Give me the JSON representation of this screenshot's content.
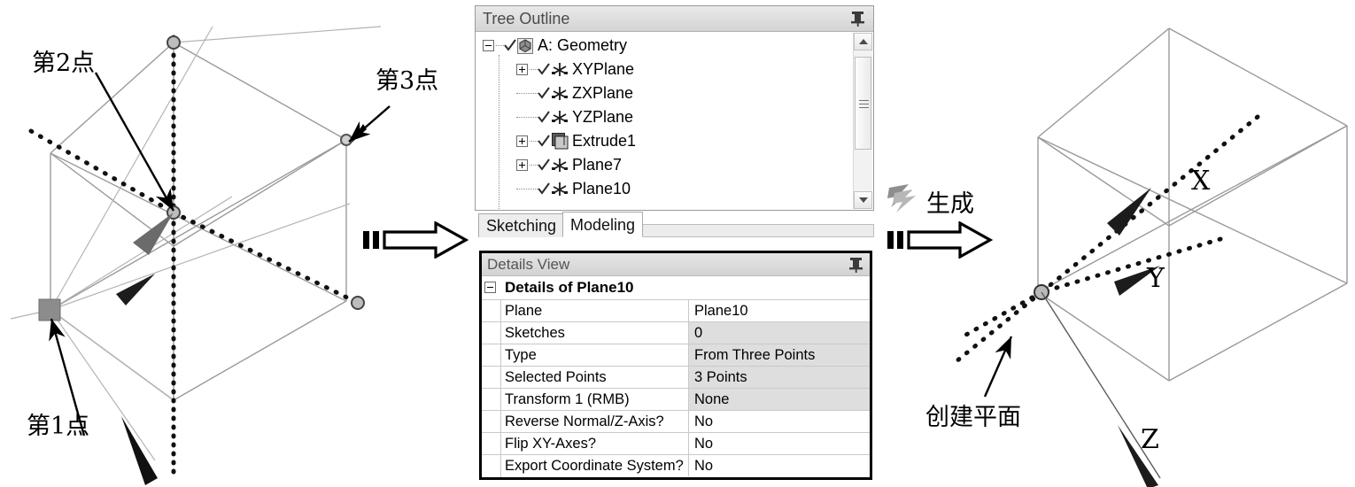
{
  "tree_panel": {
    "title": "Tree Outline",
    "pin_icon": "pin-icon",
    "items": [
      {
        "label": "A: Geometry",
        "icon": "geometry-icon",
        "expander": "minus",
        "depth": 0,
        "checked": true
      },
      {
        "label": "XYPlane",
        "icon": "plane-axis-icon",
        "expander": "plus",
        "depth": 1,
        "checked": true
      },
      {
        "label": "ZXPlane",
        "icon": "plane-axis-icon",
        "expander": "none",
        "depth": 1,
        "checked": true
      },
      {
        "label": "YZPlane",
        "icon": "plane-axis-icon",
        "expander": "none",
        "depth": 1,
        "checked": true
      },
      {
        "label": "Extrude1",
        "icon": "extrude-icon",
        "expander": "plus",
        "depth": 1,
        "checked": true
      },
      {
        "label": "Plane7",
        "icon": "plane-axis-icon",
        "expander": "plus",
        "depth": 1,
        "checked": true
      },
      {
        "label": "Plane10",
        "icon": "plane-axis-icon",
        "expander": "none",
        "depth": 1,
        "checked": true
      }
    ],
    "scrollbar": {
      "up": "scroll-up-arrow",
      "down": "scroll-down-arrow",
      "thumb": "scroll-thumb"
    },
    "tabs": [
      {
        "label": "Sketching",
        "active": false
      },
      {
        "label": "Modeling",
        "active": true
      }
    ]
  },
  "details_panel": {
    "title": "Details View",
    "pin_icon": "pin-icon",
    "section_header": "Details of Plane10",
    "rows": [
      {
        "key": "Plane",
        "value": "Plane10",
        "shaded": false
      },
      {
        "key": "Sketches",
        "value": "0",
        "shaded": true
      },
      {
        "key": "Type",
        "value": "From Three Points",
        "shaded": true
      },
      {
        "key": "Selected Points",
        "value": "3 Points",
        "shaded": true
      },
      {
        "key": "Transform 1 (RMB)",
        "value": "None",
        "shaded": true
      },
      {
        "key": "Reverse Normal/Z-Axis?",
        "value": "No",
        "shaded": false
      },
      {
        "key": "Flip XY-Axes?",
        "value": "No",
        "shaded": false
      },
      {
        "key": "Export Coordinate System?",
        "value": "No",
        "shaded": false
      }
    ]
  },
  "left_diagram": {
    "labels": {
      "point1": "第1点",
      "point2": "第2点",
      "point3": "第3点"
    }
  },
  "right_diagram": {
    "labels": {
      "axis_x": "X",
      "axis_y": "Y",
      "axis_z": "Z",
      "created_plane": "创建平面"
    }
  },
  "connectors": {
    "arrow1": "block-arrow-right",
    "arrow2": "block-arrow-right",
    "generate_label": "生成",
    "generate_icon": "lightning-generate-icon"
  },
  "colors": {
    "wireframe": "#9a9a9a",
    "dashed_plane": "#111111",
    "panel_border": "#9a9a9a",
    "titlebar_top": "#e9e9e9",
    "titlebar_bottom": "#d4d4d4",
    "row_shade": "#dedede"
  }
}
